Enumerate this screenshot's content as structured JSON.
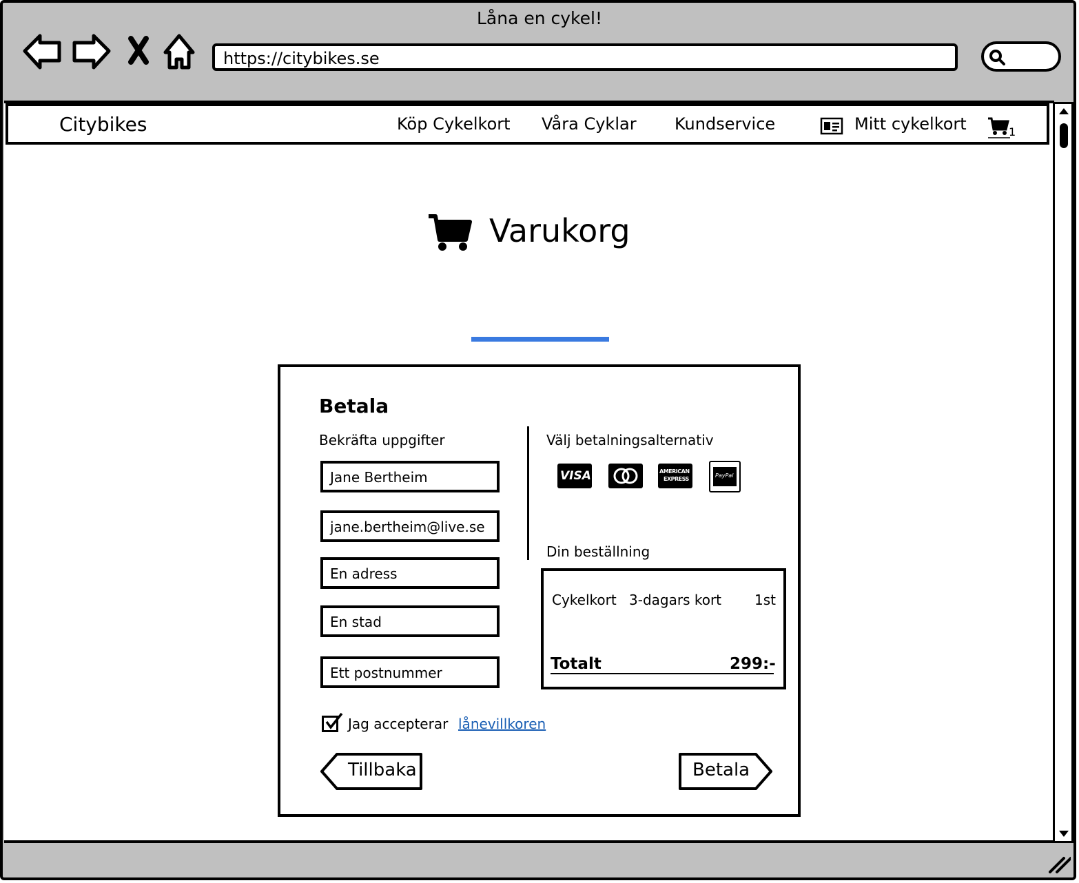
{
  "browser": {
    "window_title": "Låna en cykel!",
    "url": "https://citybikes.se",
    "nav_icons": [
      "back-arrow-icon",
      "forward-arrow-icon",
      "close-x-icon",
      "home-icon"
    ],
    "search_icon": "magnifier-icon"
  },
  "site_nav": {
    "brand": "Citybikes",
    "links": [
      "Köp Cykelkort",
      "Våra Cyklar",
      "Kundservice"
    ],
    "my_card_label": "Mitt cykelkort",
    "cart_count": "1"
  },
  "page": {
    "title": "Varukorg",
    "progress_color": "#3a7ae0"
  },
  "checkout": {
    "title": "Betala",
    "confirm_label": "Bekräfta uppgifter",
    "fields": {
      "name": "Jane Bertheim",
      "email": "jane.bertheim@live.se",
      "address": "En adress",
      "city": "En stad",
      "postcode": "Ett postnummer"
    },
    "payment_label": "Välj betalningsalternativ",
    "payment_methods": [
      {
        "name": "VISA"
      },
      {
        "name": "MasterCard"
      },
      {
        "name": "AMERICAN EXPRESS",
        "line1": "AMERICAN",
        "line2": "EXPRESS"
      },
      {
        "name": "PayPal"
      }
    ],
    "order_label": "Din beställning",
    "order_item": {
      "product": "Cykelkort",
      "type": "3-dagars kort",
      "qty": "1st"
    },
    "total_label": "Totalt",
    "total_value": "299:-",
    "terms_prefix": "Jag accepterar",
    "terms_link": "lånevillkoren",
    "terms_checked": true,
    "back_button": "Tillbaka",
    "pay_button": "Betala"
  }
}
